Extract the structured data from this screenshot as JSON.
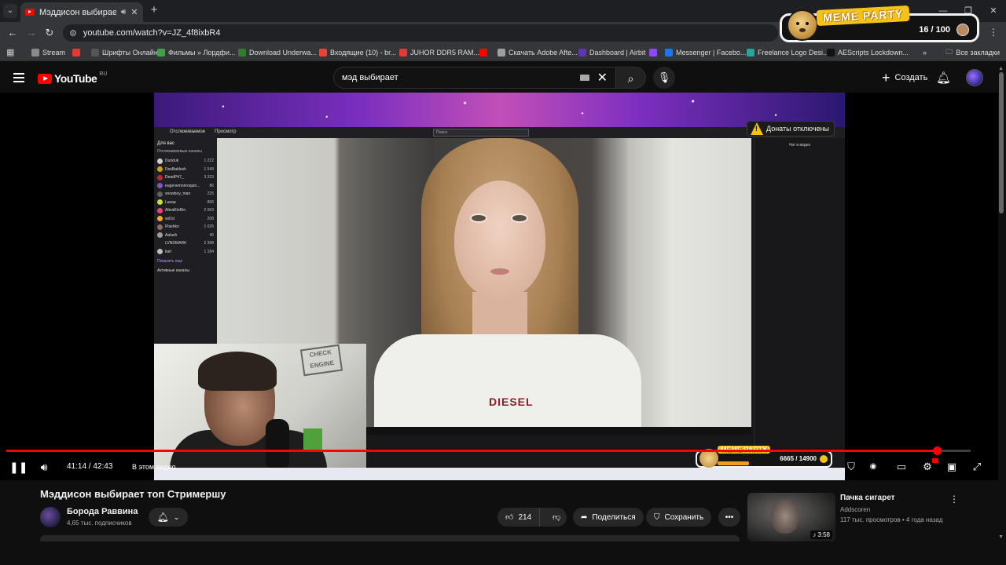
{
  "browser": {
    "tab_title": "Мэддисон выбирает топ С",
    "url": "youtube.com/watch?v=JZ_4f8ixbR4",
    "bookmarks": [
      {
        "label": "Stream",
        "color": "#8a8a8a"
      },
      {
        "label": "",
        "color": "#e53935"
      },
      {
        "label": "Шрифты Онлайн",
        "color": "#555555"
      },
      {
        "label": "Фильмы » Лордфи...",
        "color": "#43a047"
      },
      {
        "label": "Download Underwa...",
        "color": "#2e7d32"
      },
      {
        "label": "Входящие (10) - br...",
        "color": "#ea4335"
      },
      {
        "label": "JUHOR DDR5 RAM...",
        "color": "#e53935"
      },
      {
        "label": "",
        "color": "#ff0000"
      },
      {
        "label": "Скачать Adobe Afte...",
        "color": "#9e9e9e"
      },
      {
        "label": "Dashboard | Airbit",
        "color": "#5e35b1"
      },
      {
        "label": "",
        "color": "#9146ff"
      },
      {
        "label": "Messenger | Facebo...",
        "color": "#1877f2"
      },
      {
        "label": "Freelance Logo Desi...",
        "color": "#26a69a"
      },
      {
        "label": "AEScripts Lockdown...",
        "color": "#111111"
      }
    ],
    "all_bookmarks": "Все закладки"
  },
  "meme_party": {
    "title": "MEME PARTY",
    "counter": "16 / 100",
    "bottom_title": "MEME PARTY",
    "bottom_counter": "6665 / 14900"
  },
  "youtube": {
    "logo": "YouTube",
    "region": "RU",
    "search_value": "мэд выбирает",
    "create_label": "Создать"
  },
  "stream_overlay": {
    "donations": "Донаты отключены",
    "twitch_tabs": [
      "Отслеживаемое",
      "Просмотр"
    ],
    "twitch_search": "Поиск",
    "sidebar_heading": "Для вас",
    "sidebar_sub": "Отслеживаемые каналы",
    "channels": [
      {
        "name": "Dunduk",
        "count": "1 222",
        "color": "#cfcfcf"
      },
      {
        "name": "DesBaldesh",
        "count": "1 549",
        "color": "#d4a017"
      },
      {
        "name": "DeadP47_",
        "count": "3 323",
        "color": "#b03030"
      },
      {
        "name": "eugenemonroquin...",
        "count": "86",
        "color": "#7e57c2"
      },
      {
        "name": "snowboy_man",
        "count": "225",
        "color": "#616161"
      },
      {
        "name": "Lasqa",
        "count": "866",
        "color": "#cddc39"
      },
      {
        "name": "AlinaRinRin",
        "count": "2 063",
        "color": "#ec407a"
      },
      {
        "name": "sol1d",
        "count": "208",
        "color": "#f9a825"
      },
      {
        "name": "Ffashko",
        "count": "1 026",
        "color": "#8d6e63"
      },
      {
        "name": "Aalash",
        "count": "40",
        "color": "#9e9e9e"
      },
      {
        "name": "LVNDMARK",
        "count": "2 398",
        "color": "#212121"
      },
      {
        "name": "karl",
        "count": "1 184",
        "color": "#bdbdbd"
      }
    ],
    "show_more": "Показать еще",
    "active_channels": "Активные каналы",
    "chat_label": "Чат в видео",
    "shirt_text": "DIESEL",
    "sticker_text": "CHECK ENGINE"
  },
  "player": {
    "time": "41:14 / 42:43",
    "chapter": "В этом видео",
    "progress_fraction": 0.965
  },
  "video": {
    "title": "Мэддисон выбирает топ Стримершу",
    "channel": "Борода Раввина",
    "subscribers": "4,65 тыс. подписчиков",
    "likes": "214",
    "share_label": "Поделиться",
    "save_label": "Сохранить"
  },
  "recommended": {
    "title": "Пачка сигарет",
    "channel": "Addscoren",
    "meta": "117 тыс. просмотров • 4 года назад",
    "duration": "3:58"
  }
}
